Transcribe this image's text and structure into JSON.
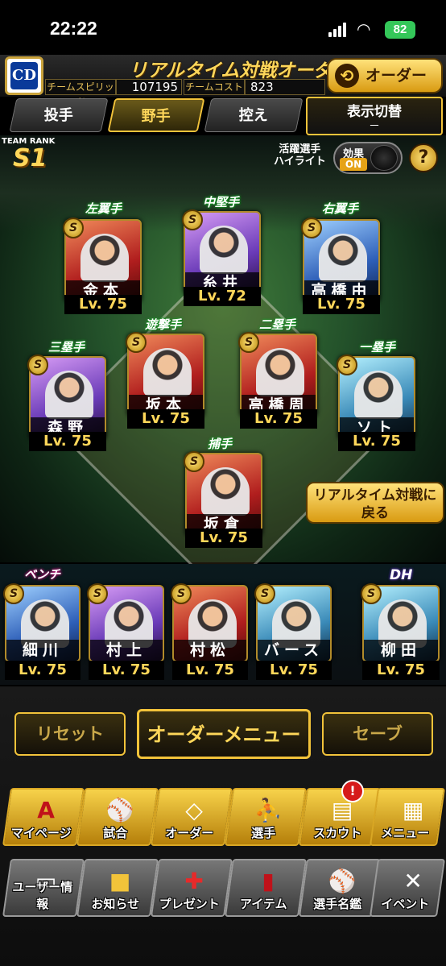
{
  "status_bar": {
    "time": "22:22",
    "battery": "82"
  },
  "header": {
    "title": "リアルタイム対戦オーダー",
    "spirits_label": "チームスピリッツ",
    "spirits_value": "107195",
    "cost_label": "チームコスト",
    "cost_value": "823",
    "team_logo": "CD",
    "order_switch": "オーダー切替"
  },
  "tabs": {
    "pitcher": "投手",
    "fielder": "野手",
    "reserve": "控え"
  },
  "display_toggle": {
    "label": "表示切替",
    "value": "－"
  },
  "team_rank": {
    "label": "TEAM RANK",
    "value": "S1"
  },
  "highlight": {
    "label_line1": "活躍選手",
    "label_line2": "ハイライト",
    "effect_label": "効果",
    "effect_state": "ON",
    "help": "?"
  },
  "lineup": {
    "lf": {
      "position": "左翼手",
      "name": "金本",
      "level": "Lv. 75"
    },
    "cf": {
      "position": "中堅手",
      "name": "糸井",
      "level": "Lv. 72"
    },
    "rf": {
      "position": "右翼手",
      "name": "高橋由",
      "level": "Lv. 75"
    },
    "ss": {
      "position": "遊撃手",
      "name": "坂本",
      "level": "Lv. 75"
    },
    "b2": {
      "position": "二塁手",
      "name": "高橋周",
      "level": "Lv. 75"
    },
    "b3": {
      "position": "三塁手",
      "name": "森野",
      "level": "Lv. 75"
    },
    "b1": {
      "position": "一塁手",
      "name": "ソト",
      "level": "Lv. 75"
    },
    "c": {
      "position": "捕手",
      "name": "坂倉",
      "level": "Lv. 75"
    }
  },
  "back_to_battle": "リアルタイム対戦に戻る",
  "bench": {
    "label": "ベンチ",
    "dh_label": "DH",
    "players": [
      {
        "name": "細川",
        "level": "Lv. 75"
      },
      {
        "name": "村上",
        "level": "Lv. 75"
      },
      {
        "name": "村松",
        "level": "Lv. 75"
      },
      {
        "name": "バース",
        "level": "Lv. 75"
      }
    ],
    "dh": {
      "name": "柳田",
      "level": "Lv. 75"
    }
  },
  "actions": {
    "reset": "リセット",
    "order_menu": "オーダーメニュー",
    "save": "セーブ"
  },
  "menu_row1": [
    "マイページ",
    "試合",
    "オーダー",
    "選手",
    "スカウト",
    "メニュー"
  ],
  "menu_row2": [
    "ユーザー情報",
    "お知らせ",
    "プレゼント",
    "アイテム",
    "選手名鑑",
    "イベント"
  ],
  "scout_badge": "!",
  "colors": {
    "gold": "#ffd75a",
    "accent_border": "#f2c33a",
    "green_label": "#1b9a2a"
  }
}
